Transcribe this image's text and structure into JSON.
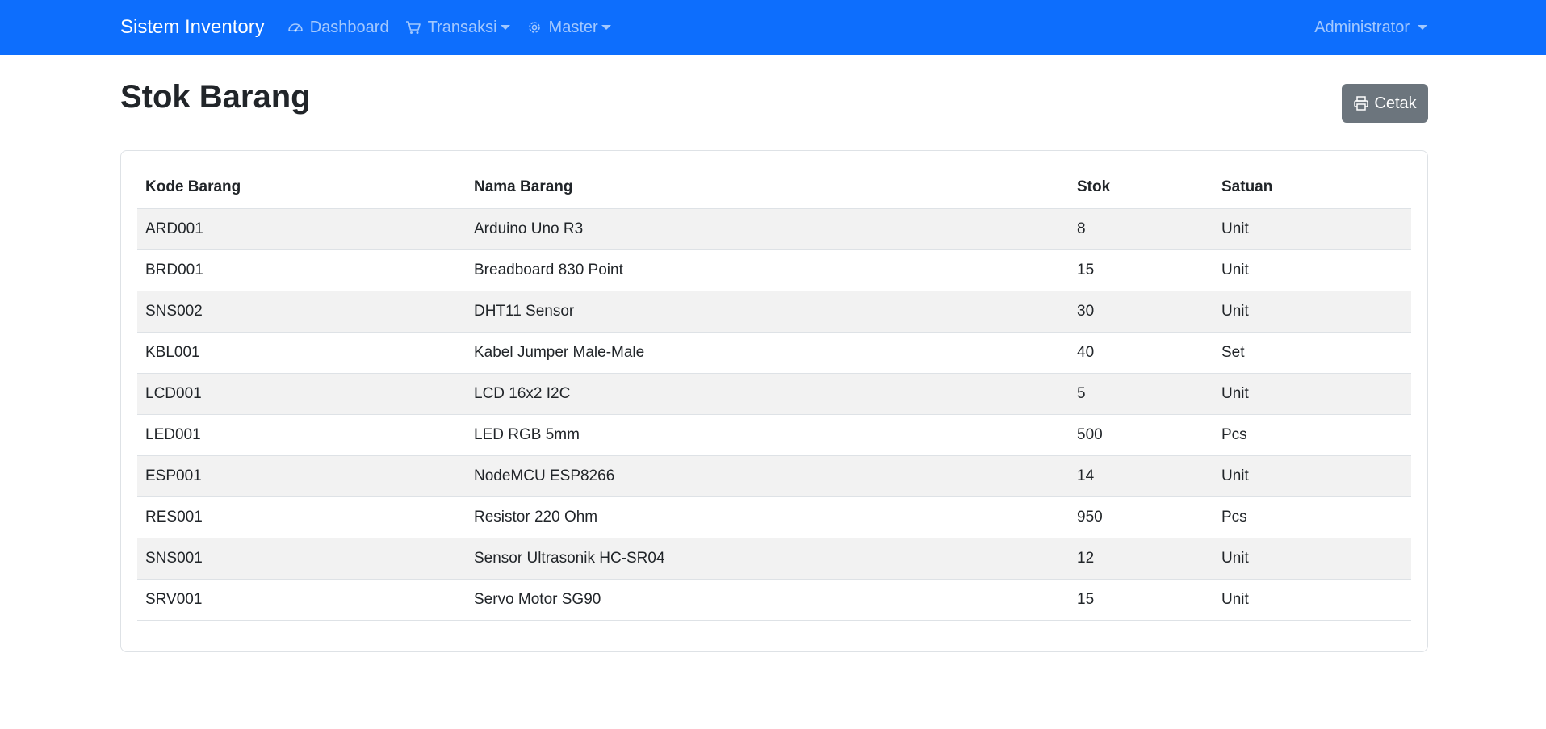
{
  "navbar": {
    "brand": "Sistem Inventory",
    "items": [
      {
        "label": "Dashboard",
        "icon": "speedometer-icon",
        "dropdown": false
      },
      {
        "label": "Transaksi",
        "icon": "cart-icon",
        "dropdown": true
      },
      {
        "label": "Master",
        "icon": "gear-icon",
        "dropdown": true
      }
    ],
    "user": "Administrator",
    "background_color": "#0d6efd"
  },
  "page": {
    "title": "Stok Barang",
    "print_button": {
      "label": "Cetak",
      "icon": "printer-icon",
      "color": "#6c757d"
    }
  },
  "table": {
    "columns": [
      "Kode Barang",
      "Nama Barang",
      "Stok",
      "Satuan"
    ],
    "rows": [
      [
        "ARD001",
        "Arduino Uno R3",
        "8",
        "Unit"
      ],
      [
        "BRD001",
        "Breadboard 830 Point",
        "15",
        "Unit"
      ],
      [
        "SNS002",
        "DHT11 Sensor",
        "30",
        "Unit"
      ],
      [
        "KBL001",
        "Kabel Jumper Male-Male",
        "40",
        "Set"
      ],
      [
        "LCD001",
        "LCD 16x2 I2C",
        "5",
        "Unit"
      ],
      [
        "LED001",
        "LED RGB 5mm",
        "500",
        "Pcs"
      ],
      [
        "ESP001",
        "NodeMCU ESP8266",
        "14",
        "Unit"
      ],
      [
        "RES001",
        "Resistor 220 Ohm",
        "950",
        "Pcs"
      ],
      [
        "SNS001",
        "Sensor Ultrasonik HC-SR04",
        "12",
        "Unit"
      ],
      [
        "SRV001",
        "Servo Motor SG90",
        "15",
        "Unit"
      ]
    ]
  }
}
